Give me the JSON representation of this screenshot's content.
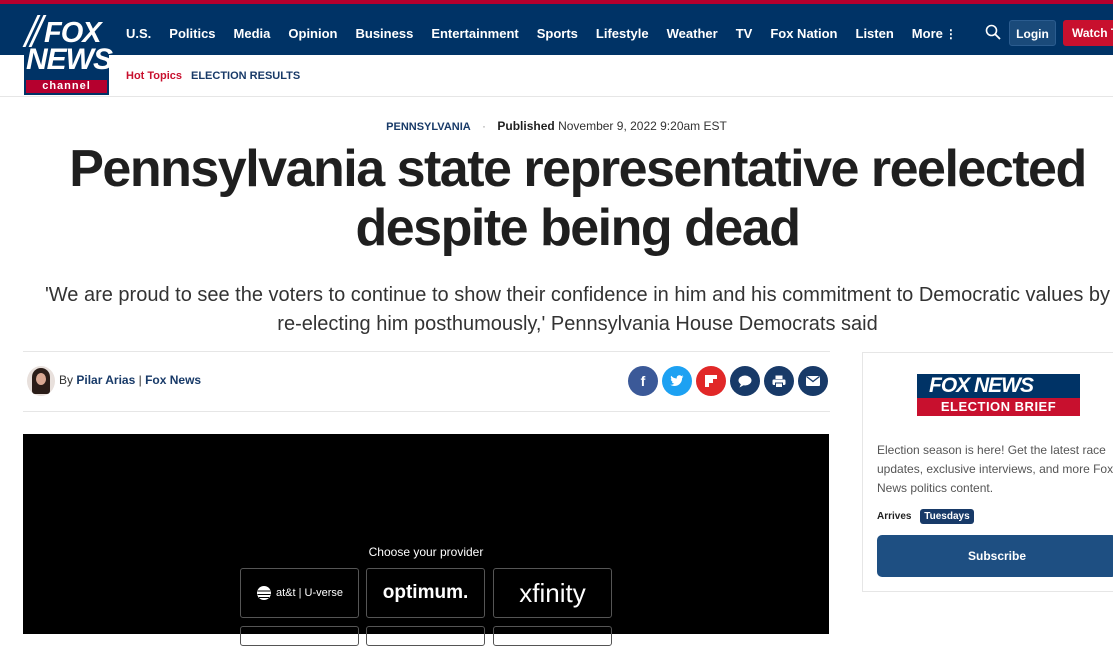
{
  "brand": {
    "logo_line1": "FOX",
    "logo_line2": "NEWS",
    "logo_line3": "channel"
  },
  "nav": {
    "items": [
      "U.S.",
      "Politics",
      "Media",
      "Opinion",
      "Business",
      "Entertainment",
      "Sports",
      "Lifestyle",
      "Weather",
      "TV",
      "Fox Nation",
      "Listen",
      "More"
    ],
    "login_label": "Login",
    "watch_label": "Watch TV"
  },
  "subnav": {
    "hot_topics": "Hot Topics",
    "election_results": "ELECTION RESULTS"
  },
  "article": {
    "category": "PENNSYLVANIA",
    "published_label": "Published",
    "published_date": "November 9, 2022 9:20am EST",
    "headline": "Pennsylvania state representative reelected despite being dead",
    "subhead": "'We are proud to see the voters to continue to show their confidence in him and his commitment to Democratic values by re-electing him posthumously,' Pennsylvania House Democrats said",
    "byline_prefix": "By",
    "author": "Pilar Arias",
    "separator": "|",
    "outlet": "Fox News"
  },
  "share_icons": [
    "facebook-icon",
    "twitter-icon",
    "flipboard-icon",
    "comments-icon",
    "print-icon",
    "email-icon"
  ],
  "video": {
    "choose_label": "Choose your provider",
    "providers": [
      "at&t | U-verse",
      "optimum.",
      "xfinity"
    ]
  },
  "sidebar": {
    "badge_top": "FOX NEWS",
    "badge_bottom": "ELECTION BRIEF",
    "description": "Election season is here! Get the latest race updates, exclusive interviews, and more Fox News politics content.",
    "arrives_label": "Arrives",
    "arrives_day": "Tuesdays",
    "subscribe_label": "Subscribe"
  },
  "colors": {
    "navy": "#003366",
    "red": "#c8102e",
    "link": "#183a68"
  }
}
